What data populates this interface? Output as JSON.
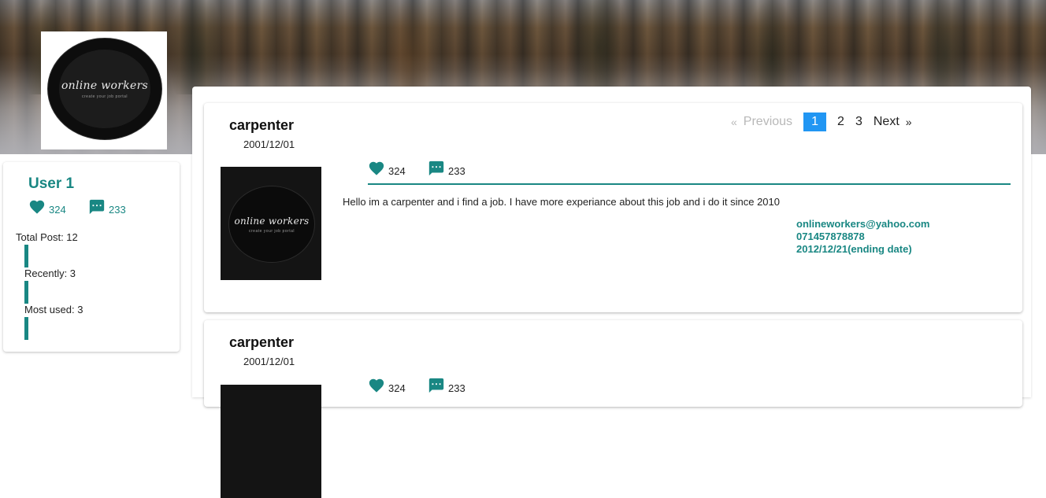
{
  "brand": {
    "logo_text": "online workers",
    "logo_tagline": "create your job portal"
  },
  "colors": {
    "accent": "#198783",
    "active_page": "#2196f3"
  },
  "icons": {
    "like": "heart-icon",
    "comment": "comment-icon"
  },
  "user": {
    "name": "User 1",
    "likes": "324",
    "comments": "233",
    "stats": [
      {
        "label": "Total Post: 12"
      },
      {
        "label": "Recently: 3"
      },
      {
        "label": "Most used: 3"
      }
    ]
  },
  "pagination": {
    "prev_arrow": "«",
    "previous": "Previous",
    "pages": [
      "1",
      "2",
      "3"
    ],
    "active_page": "1",
    "next": "Next",
    "next_arrow": "»"
  },
  "posts": [
    {
      "title": "carpenter",
      "date": "2001/12/01",
      "likes": "324",
      "comments": "233",
      "description": "Hello im a carpenter and i find a job. I have more experiance about this job and i do it since 2010",
      "email": "onlineworkers@yahoo.com",
      "phone": "071457878878",
      "ending_date": "2012/12/21(ending date)"
    },
    {
      "title": "carpenter",
      "date": "2001/12/01",
      "likes": "324",
      "comments": "233"
    }
  ]
}
